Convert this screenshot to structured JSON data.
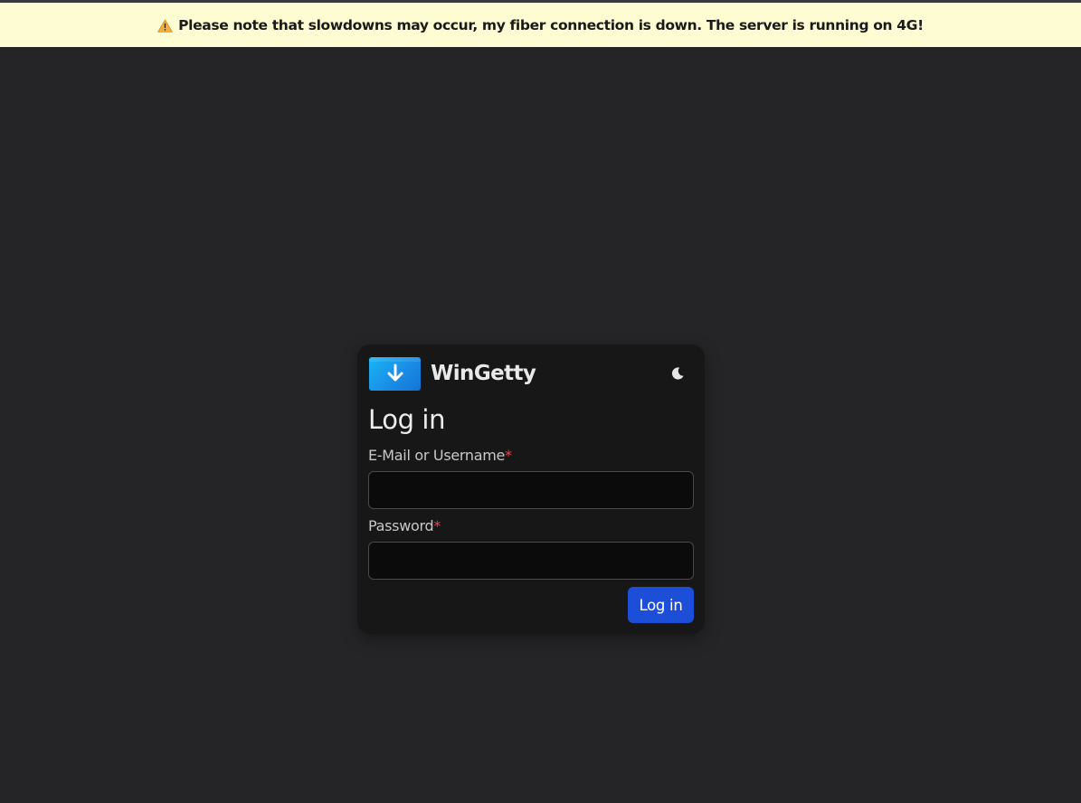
{
  "banner": {
    "icon": "warning-icon",
    "message": "Please note that slowdowns may occur, my fiber connection is down. The server is running on 4G!"
  },
  "header": {
    "logo_icon": "download-arrow-icon",
    "brand": "WinGetty",
    "theme_toggle_icon": "moon-icon"
  },
  "login": {
    "title": "Log in",
    "username_label": "E-Mail or Username",
    "username_value": "",
    "password_label": "Password",
    "password_value": "",
    "required_marker": "*",
    "submit_label": "Log in"
  },
  "colors": {
    "background": "#252528",
    "banner_background": "#fefcd2",
    "card_background": "#171718",
    "input_background": "#0b0b0c",
    "accent": "#1c4ed8",
    "required": "#e5484d",
    "logo_gradient_start": "#18b6f6",
    "logo_gradient_end": "#1473d6"
  }
}
